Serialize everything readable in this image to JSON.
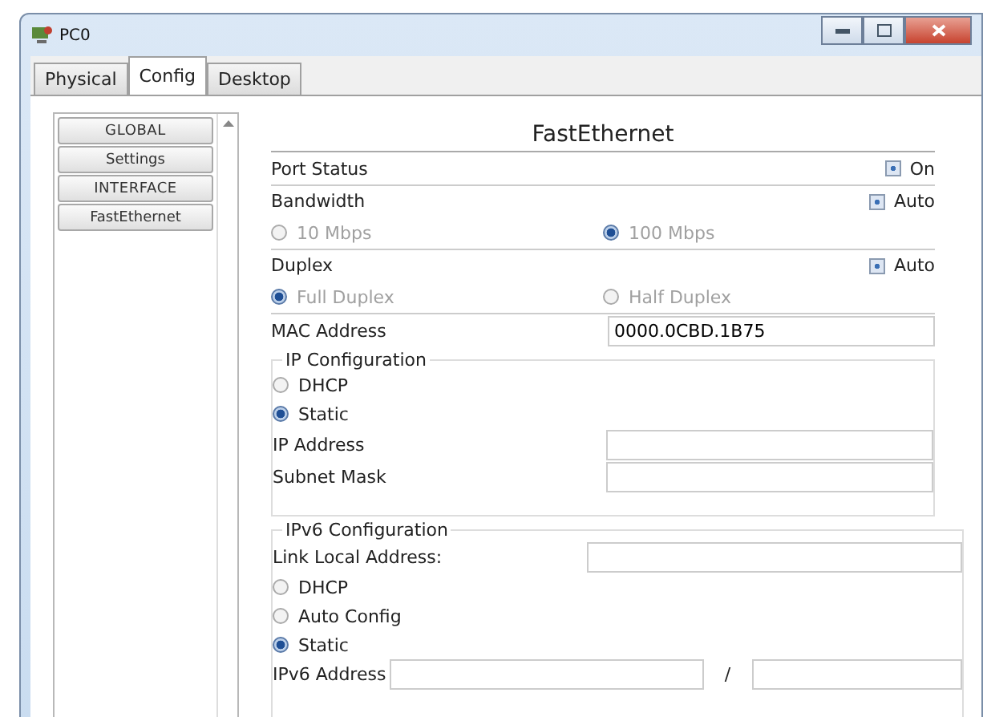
{
  "window": {
    "title": "PC0"
  },
  "tabs": [
    {
      "label": "Physical",
      "selected": false
    },
    {
      "label": "Config",
      "selected": true
    },
    {
      "label": "Desktop",
      "selected": false
    }
  ],
  "sidebar": {
    "items": [
      {
        "label": "GLOBAL",
        "kind": "header"
      },
      {
        "label": "Settings",
        "kind": "item"
      },
      {
        "label": "INTERFACE",
        "kind": "header"
      },
      {
        "label": "FastEthernet",
        "kind": "item"
      }
    ]
  },
  "panel": {
    "title": "FastEthernet",
    "port_status": {
      "label": "Port Status",
      "option": "On",
      "checked": true
    },
    "bandwidth": {
      "label": "Bandwidth",
      "option": "Auto",
      "checked": true,
      "choices": [
        {
          "label": "10 Mbps",
          "selected": false,
          "disabled": true
        },
        {
          "label": "100 Mbps",
          "selected": true,
          "disabled": true
        }
      ]
    },
    "duplex": {
      "label": "Duplex",
      "option": "Auto",
      "checked": true,
      "choices": [
        {
          "label": "Full Duplex",
          "selected": true,
          "disabled": true
        },
        {
          "label": "Half Duplex",
          "selected": false,
          "disabled": true
        }
      ]
    },
    "mac": {
      "label": "MAC Address",
      "value": "0000.0CBD.1B75"
    },
    "ip_config": {
      "title": "IP Configuration",
      "modes": [
        {
          "label": "DHCP",
          "selected": false
        },
        {
          "label": "Static",
          "selected": true
        }
      ],
      "fields": [
        {
          "label": "IP Address"
        },
        {
          "label": "Subnet Mask"
        }
      ]
    },
    "ipv6_config": {
      "title": "IPv6 Configuration",
      "link_local_label": "Link Local Address:",
      "modes": [
        {
          "label": "DHCP",
          "selected": false
        },
        {
          "label": "Auto Config",
          "selected": false
        },
        {
          "label": "Static",
          "selected": true
        }
      ],
      "address_label": "IPv6 Address",
      "separator": "/"
    }
  }
}
